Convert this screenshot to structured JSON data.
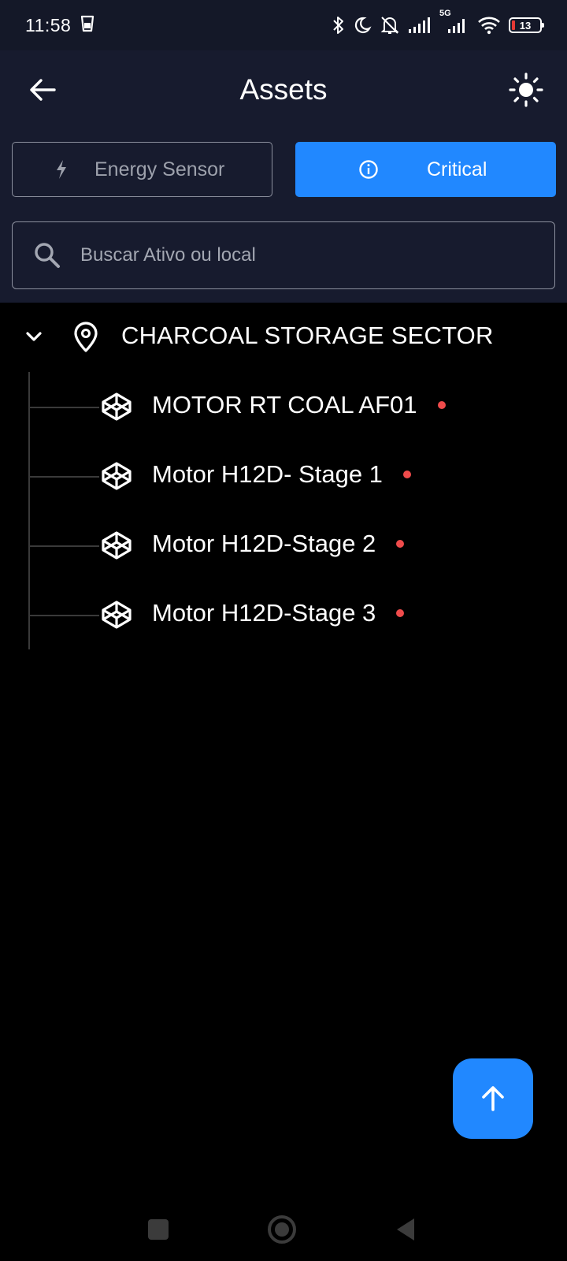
{
  "status_bar": {
    "time": "11:58",
    "network": "5G",
    "battery": "13",
    "icons": [
      "clipboard-icon",
      "bluetooth-icon",
      "moon-icon",
      "bell-off-icon",
      "signal-icon",
      "signal-5g-icon",
      "wifi-icon",
      "battery-icon"
    ]
  },
  "app_bar": {
    "title": "Assets",
    "back_icon": "arrow-left-icon",
    "theme_icon": "sun-icon"
  },
  "filters": [
    {
      "label": "Energy Sensor",
      "icon": "bolt-icon",
      "selected": false
    },
    {
      "label": "Critical",
      "icon": "info-circle-icon",
      "selected": true
    }
  ],
  "search": {
    "value": "",
    "placeholder": "Buscar Ativo ou local"
  },
  "tree": {
    "location": {
      "label": "CHARCOAL STORAGE SECTOR",
      "icon": "location-pin-icon",
      "expanded": true
    },
    "assets": [
      {
        "label": "MOTOR RT COAL AF01",
        "icon": "component-icon",
        "status": "critical"
      },
      {
        "label": "Motor H12D- Stage 1",
        "icon": "component-icon",
        "status": "critical"
      },
      {
        "label": "Motor H12D-Stage 2",
        "icon": "component-icon",
        "status": "critical"
      },
      {
        "label": "Motor H12D-Stage 3",
        "icon": "component-icon",
        "status": "critical"
      }
    ]
  },
  "fab": {
    "icon": "arrow-up-icon"
  },
  "colors": {
    "accent": "#2188FF",
    "header_bg": "#171B2E",
    "critical_dot": "#EF4B4B",
    "background": "#000000"
  }
}
